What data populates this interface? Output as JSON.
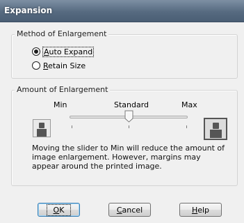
{
  "window": {
    "title": "Expansion"
  },
  "method_group": {
    "legend": "Method of Enlargement",
    "options": [
      {
        "accel": "A",
        "rest": "uto Expand",
        "checked": true
      },
      {
        "accel": "R",
        "rest": "etain Size",
        "checked": false
      }
    ]
  },
  "amount_group": {
    "legend": "Amount of Enlargement",
    "slider": {
      "labels": {
        "min": "Min",
        "standard": "Standard",
        "max": "Max"
      },
      "position": "Standard"
    },
    "min_icon": "person-small-icon",
    "max_icon": "person-large-icon",
    "description": "Moving the slider to Min will reduce the amount of image enlargement. However, margins may appear around the printed image."
  },
  "buttons": {
    "ok": {
      "accel": "O",
      "rest": "K"
    },
    "cancel": {
      "accel": "C",
      "rest": "ancel"
    },
    "help": {
      "accel": "H",
      "rest": "elp"
    }
  },
  "colors": {
    "titlebar": "#566a80",
    "dialog_bg": "#f0f0f0",
    "default_button_border": "#3c7fb1"
  }
}
